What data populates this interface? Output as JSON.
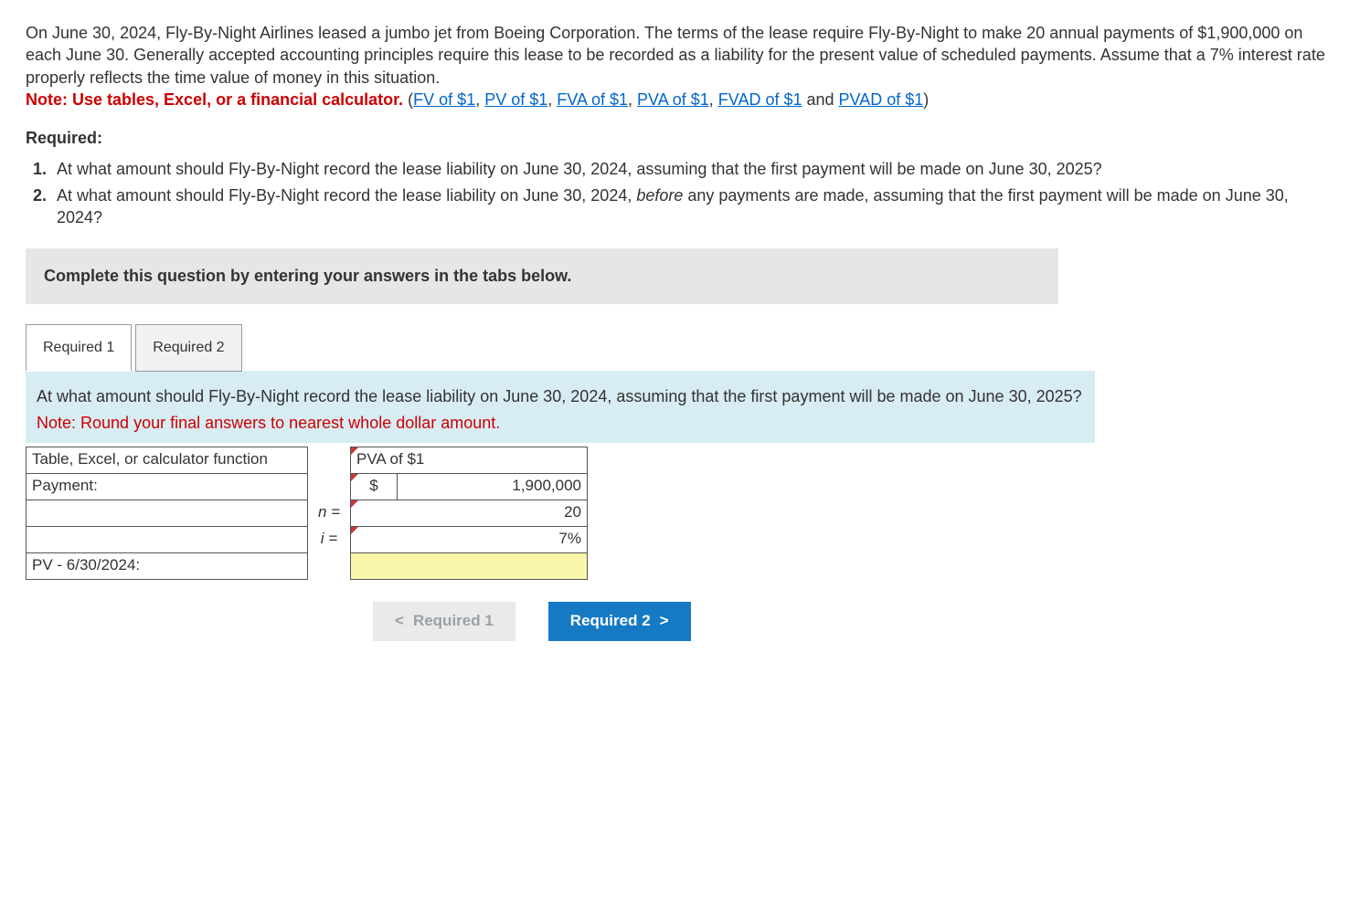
{
  "problem": {
    "text": "On June 30, 2024, Fly-By-Night Airlines leased a jumbo jet from Boeing Corporation. The terms of the lease require Fly-By-Night to make 20 annual payments of $1,900,000 on each June 30. Generally accepted accounting principles require this lease to be recorded as a liability for the present value of scheduled payments. Assume that a 7% interest rate properly reflects the time value of money in this situation.",
    "note_label": "Note: Use tables, Excel, or a financial calculator.",
    "links": {
      "fv": "FV of $1",
      "pv": "PV of $1",
      "fva": "FVA of $1",
      "pva": "PVA of $1",
      "fvad": "FVAD of $1",
      "pvad": "PVAD of $1"
    },
    "and": " and "
  },
  "required_heading": "Required:",
  "requirements": [
    "At what amount should Fly-By-Night record the lease liability on June 30, 2024, assuming that the first payment will be made on June 30, 2025?",
    "At what amount should Fly-By-Night record the lease liability on June 30, 2024, before any payments are made, assuming that the first payment will be made on June 30, 2024?"
  ],
  "req2_before_word": "before",
  "instruction_box": "Complete this question by entering your answers in the tabs below.",
  "tabs": {
    "tab1": "Required 1",
    "tab2": "Required 2"
  },
  "panel": {
    "question": "At what amount should Fly-By-Night record the lease liability on June 30, 2024, assuming that the first payment will be made on June 30, 2025?",
    "note": "Note: Round your final answers to nearest whole dollar amount."
  },
  "table": {
    "row1_label": "Table, Excel, or calculator function",
    "row1_value": "PVA of $1",
    "row2_label": "Payment:",
    "row2_currency": "$",
    "row2_value": "1,900,000",
    "row3_sym": "n =",
    "row3_value": "20",
    "row4_sym": "i =",
    "row4_value": "7%",
    "row5_label": "PV - 6/30/2024:",
    "row5_value": ""
  },
  "nav": {
    "prev": "Required 1",
    "next": "Required 2",
    "chev_left": "<",
    "chev_right": ">"
  }
}
